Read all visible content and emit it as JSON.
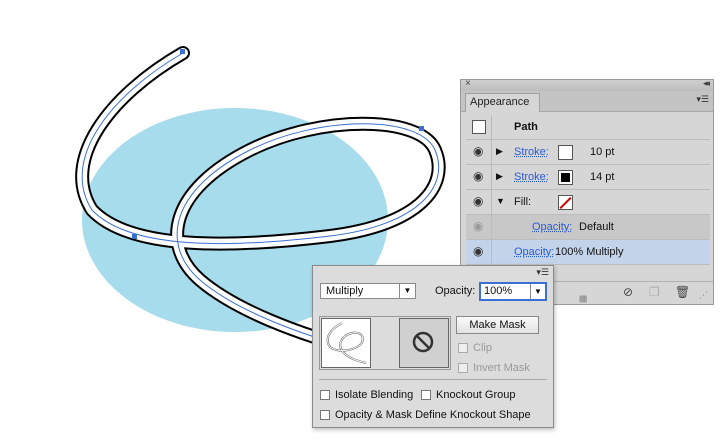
{
  "appearance": {
    "tab_title": "Appearance",
    "close_icon": "×",
    "collapse_icon": "◂◂",
    "menu_icon": "▾☰",
    "rows": [
      {
        "label": "Path",
        "kind": "header"
      },
      {
        "label": "Stroke:",
        "value": "10 pt",
        "swatch": "white"
      },
      {
        "label": "Stroke:",
        "value": "14 pt",
        "swatch": "black"
      },
      {
        "label": "Fill:",
        "swatch": "none"
      },
      {
        "label": "Opacity:",
        "value": "Default"
      },
      {
        "label": "Opacity:",
        "value": "100% Multiply"
      }
    ]
  },
  "transparency": {
    "blend_mode": "Multiply",
    "opacity_label": "Opacity:",
    "opacity_value": "100%",
    "make_mask": "Make Mask",
    "clip": "Clip",
    "invert_mask": "Invert Mask",
    "isolate_blending": "Isolate Blending",
    "knockout_group": "Knockout Group",
    "opacity_mask_define": "Opacity & Mask Define Knockout Shape"
  },
  "colors": {
    "ellipse_fill": "#a6dcec",
    "selection_blue": "#3b6fd4",
    "link_blue": "#2a5bd7"
  }
}
